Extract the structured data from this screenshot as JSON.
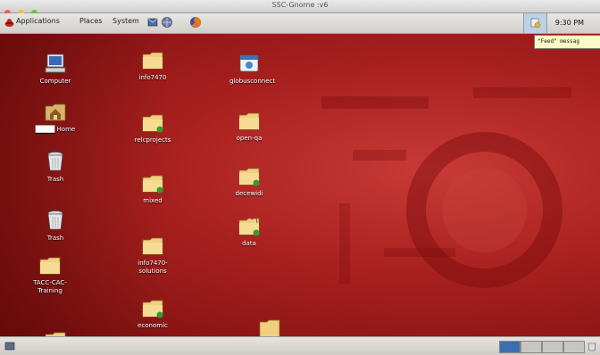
{
  "window": {
    "title": "SSC-Gnome :v6"
  },
  "panel": {
    "menus": [
      "Applications",
      "Places",
      "System"
    ],
    "clock": "9:30 PM",
    "tooltip": "\"Feed\" messag"
  },
  "desktop": {
    "icons": [
      {
        "label": "Computer",
        "icon": "computer-icon"
      },
      {
        "label": "████ Home",
        "icon": "home-folder-icon"
      },
      {
        "label": "Trash",
        "icon": "trash-icon"
      },
      {
        "label": "Trash",
        "icon": "trash-icon"
      },
      {
        "label": "TACC-CAC-Training",
        "icon": "folder-icon"
      },
      {
        "label": "info7470",
        "icon": "folder-icon"
      },
      {
        "label": "relcprojects",
        "icon": "folder-link-icon"
      },
      {
        "label": "mixed",
        "icon": "folder-link-icon"
      },
      {
        "label": "info7470-solutions",
        "icon": "folder-icon"
      },
      {
        "label": "economic",
        "icon": "folder-link-icon"
      },
      {
        "label": "globusconnect",
        "icon": "application-icon"
      },
      {
        "label": "open-qa",
        "icon": "folder-icon"
      },
      {
        "label": "decewidi",
        "icon": "folder-link-icon"
      },
      {
        "label": "data",
        "icon": "folder-link-icon"
      }
    ]
  },
  "colors": {
    "desktop": "#a8201e",
    "folder": "#f0d080",
    "link_badge": "#2e9e2e"
  }
}
